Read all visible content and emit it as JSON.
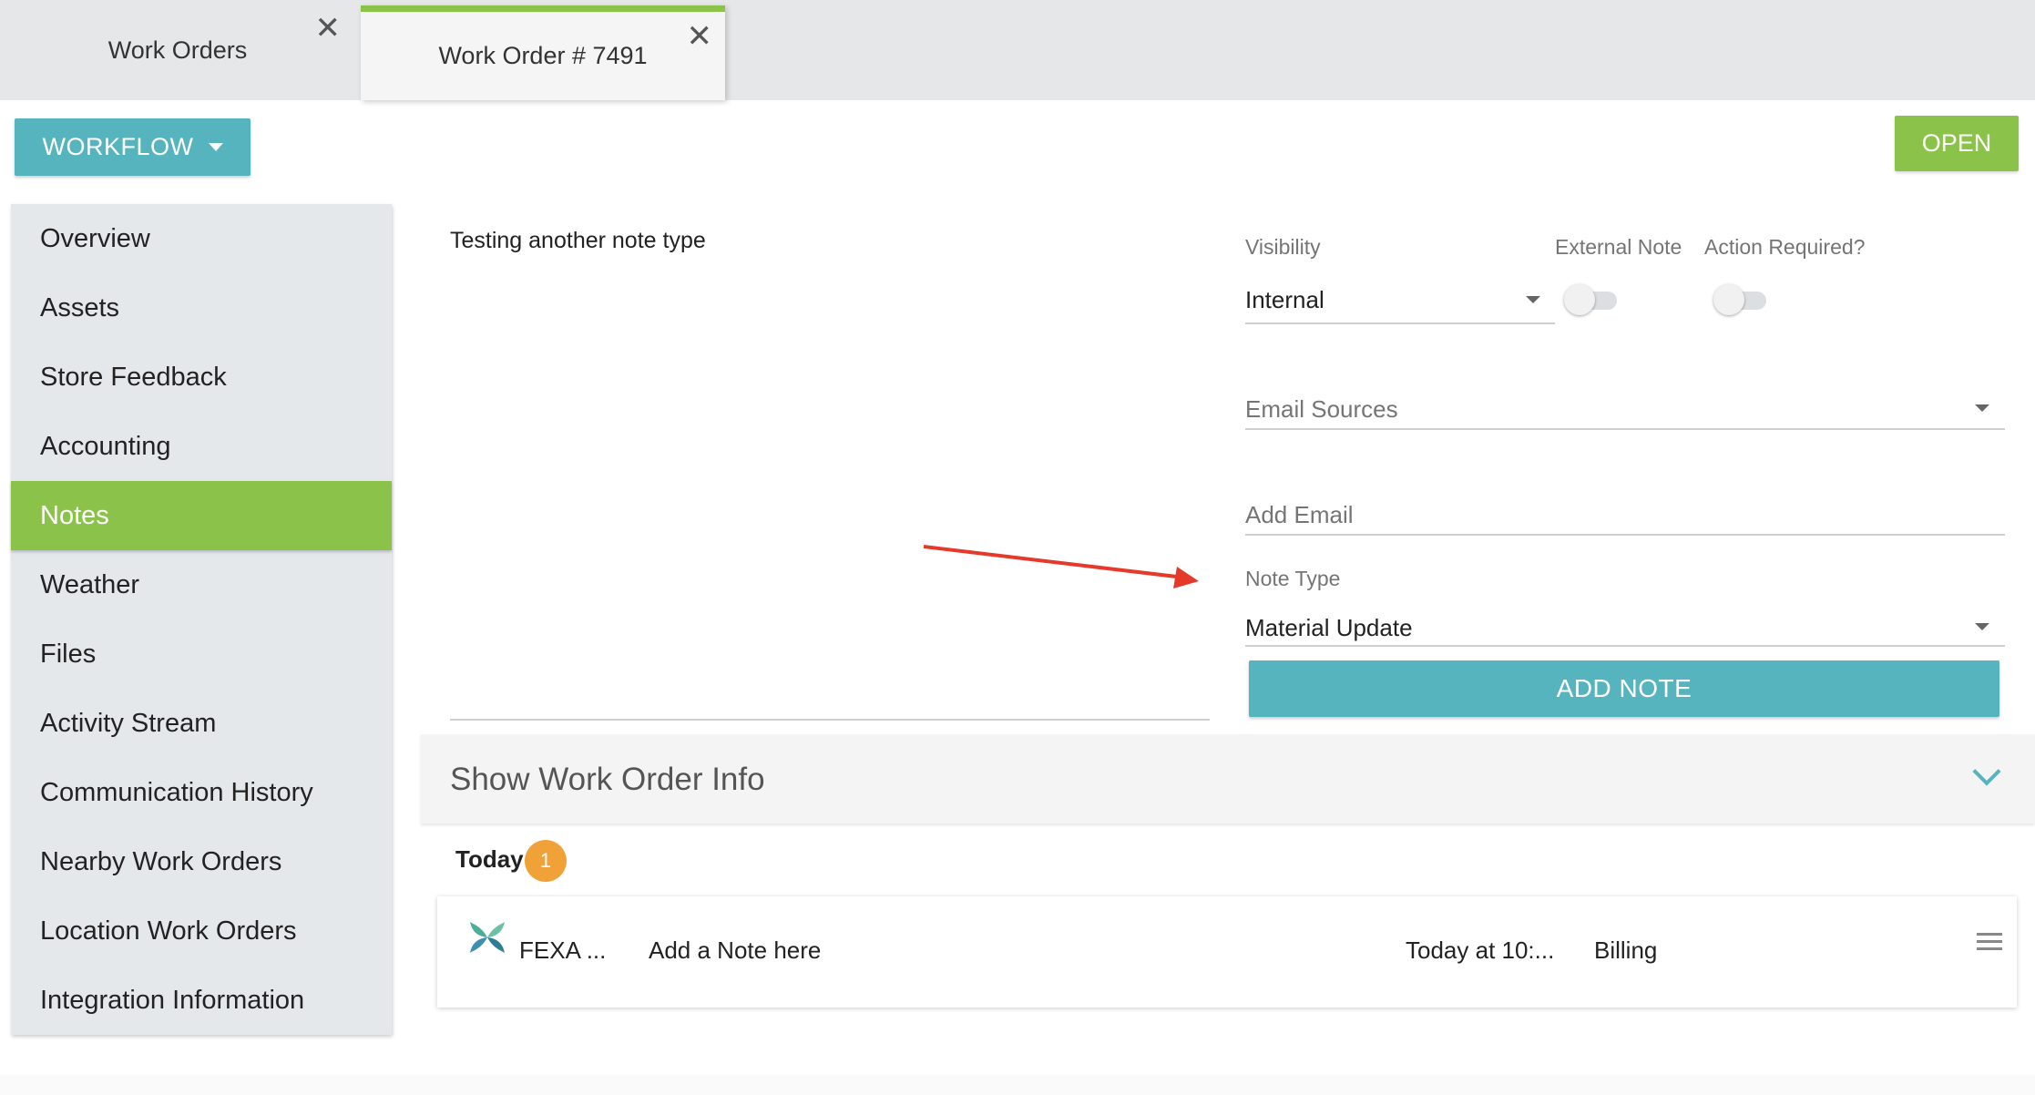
{
  "tabs": [
    {
      "label": "Work Orders",
      "active": false
    },
    {
      "label": "Work Order # 7491",
      "active": true
    }
  ],
  "workflow_button": "WORKFLOW",
  "status_button": "OPEN",
  "sidebar": {
    "items": [
      {
        "label": "Overview"
      },
      {
        "label": "Assets"
      },
      {
        "label": "Store Feedback"
      },
      {
        "label": "Accounting"
      },
      {
        "label": "Notes",
        "active": true
      },
      {
        "label": "Weather"
      },
      {
        "label": "Files"
      },
      {
        "label": "Activity Stream"
      },
      {
        "label": "Communication History"
      },
      {
        "label": "Nearby Work Orders"
      },
      {
        "label": "Location Work Orders"
      },
      {
        "label": "Integration Information"
      }
    ]
  },
  "note_form": {
    "note_text": "Testing another note type",
    "visibility_label": "Visibility",
    "visibility_value": "Internal",
    "external_note_label": "External Note",
    "external_note_on": false,
    "action_required_label": "Action Required?",
    "action_required_on": false,
    "email_sources_placeholder": "Email Sources",
    "add_email_placeholder": "Add Email",
    "note_type_label": "Note Type",
    "note_type_value": "Material Update",
    "add_note_button": "ADD NOTE"
  },
  "info_section": {
    "title": "Show Work Order Info"
  },
  "notes_list": {
    "group_label": "Today",
    "group_count": "1",
    "items": [
      {
        "author": "FEXA ...",
        "text": "Add a Note here",
        "time": "Today at 10:...",
        "type": "Billing"
      }
    ]
  },
  "colors": {
    "accent_teal": "#56b4be",
    "accent_green": "#8bc34a",
    "badge_orange": "#f0a238",
    "annotation_arrow": "#e53a2a"
  },
  "icons": [
    "close-icon",
    "caret-down-icon",
    "chevron-down-icon",
    "fexa-logo-icon",
    "hamburger-menu-icon",
    "arrow-annotation"
  ]
}
